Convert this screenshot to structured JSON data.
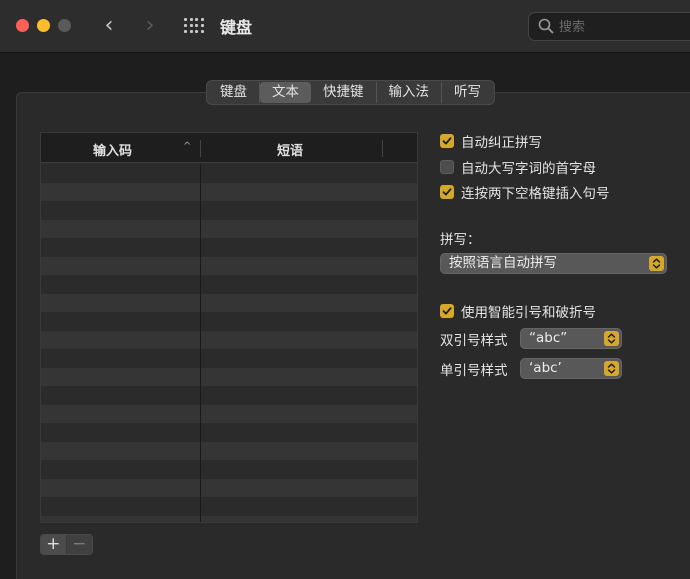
{
  "window": {
    "title": "键盘",
    "search_placeholder": "搜索"
  },
  "tabs": [
    {
      "label": "键盘",
      "active": false
    },
    {
      "label": "文本",
      "active": true
    },
    {
      "label": "快捷键",
      "active": false
    },
    {
      "label": "输入法",
      "active": false
    },
    {
      "label": "听写",
      "active": false
    }
  ],
  "table": {
    "headers": {
      "code": "输入码",
      "phrase": "短语"
    },
    "rows": []
  },
  "buttons": {
    "add": "+",
    "remove": "−"
  },
  "options": {
    "auto_correct": {
      "label": "自动纠正拼写",
      "checked": true
    },
    "auto_capitalize": {
      "label": "自动大写字词的首字母",
      "checked": false
    },
    "double_space_period": {
      "label": "连按两下空格键插入句号",
      "checked": true
    },
    "spelling_label": "拼写：",
    "spelling_value": "按照语言自动拼写",
    "smart_quotes": {
      "label": "使用智能引号和破折号",
      "checked": true
    },
    "double_quote_label": "双引号样式",
    "double_quote_value": "“abc”",
    "single_quote_label": "单引号样式",
    "single_quote_value": "‘abc’"
  },
  "colors": {
    "accent": "#d5a82c",
    "close": "#ff5f57",
    "minimize": "#febc2e"
  }
}
